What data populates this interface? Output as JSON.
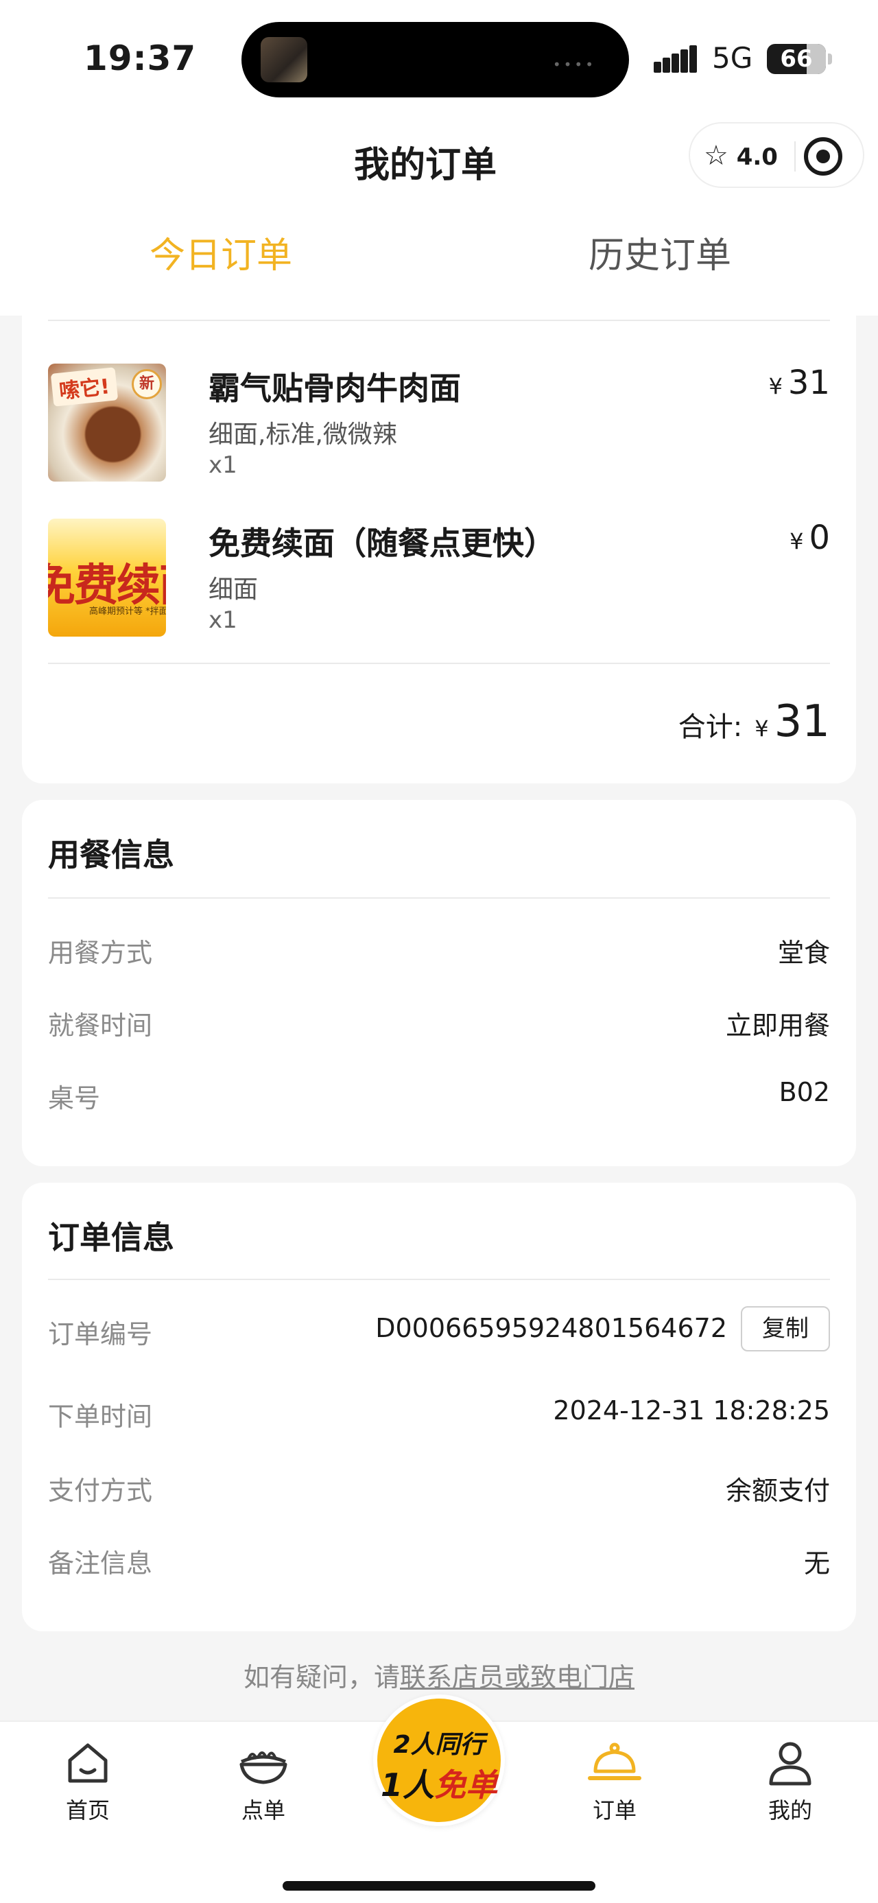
{
  "status_bar": {
    "time": "19:37",
    "network": "5G",
    "battery": "66"
  },
  "header": {
    "title": "我的订单",
    "rating": "4.0",
    "tabs": [
      {
        "label": "今日订单",
        "active": true
      },
      {
        "label": "历史订单",
        "active": false
      }
    ]
  },
  "order_items": [
    {
      "name": "霸气贴骨肉牛肉面",
      "spec": "细面,标准,微微辣",
      "qty": "x1",
      "price": "31",
      "image_tag": "嗦它!",
      "image_badge": "新"
    },
    {
      "name": "免费续面（随餐点更快）",
      "spec": "细面",
      "qty": "x1",
      "price": "0",
      "image_text": "免费续面",
      "image_caption": "高峰期预计等 *拌面、凉"
    }
  ],
  "currency": "¥",
  "total": {
    "label": "合计:",
    "value": "31"
  },
  "dining_info": {
    "title": "用餐信息",
    "rows": [
      {
        "label": "用餐方式",
        "value": "堂食"
      },
      {
        "label": "就餐时间",
        "value": "立即用餐"
      },
      {
        "label": "桌号",
        "value": "B02"
      }
    ]
  },
  "order_info": {
    "title": "订单信息",
    "copy_label": "复制",
    "rows": [
      {
        "label": "订单编号",
        "value": "D000665959248015646​72"
      },
      {
        "label": "下单时间",
        "value": "2024-12-31 18:28:25"
      },
      {
        "label": "支付方式",
        "value": "余额支付"
      },
      {
        "label": "备注信息",
        "value": "无"
      }
    ]
  },
  "help": {
    "prefix": "如有疑问，请",
    "link": "联系店员或致电门店"
  },
  "tab_bar": {
    "items": [
      {
        "label": "首页"
      },
      {
        "label": "点单"
      },
      {
        "label": "订单",
        "active": true
      },
      {
        "label": "我的"
      }
    ],
    "promo_line1": "2人同行",
    "promo_line2_a": "1人",
    "promo_line2_b": "免单"
  },
  "colors": {
    "accent": "#f2b322",
    "promo": "#f7b50c",
    "promo_red": "#d6261c"
  }
}
